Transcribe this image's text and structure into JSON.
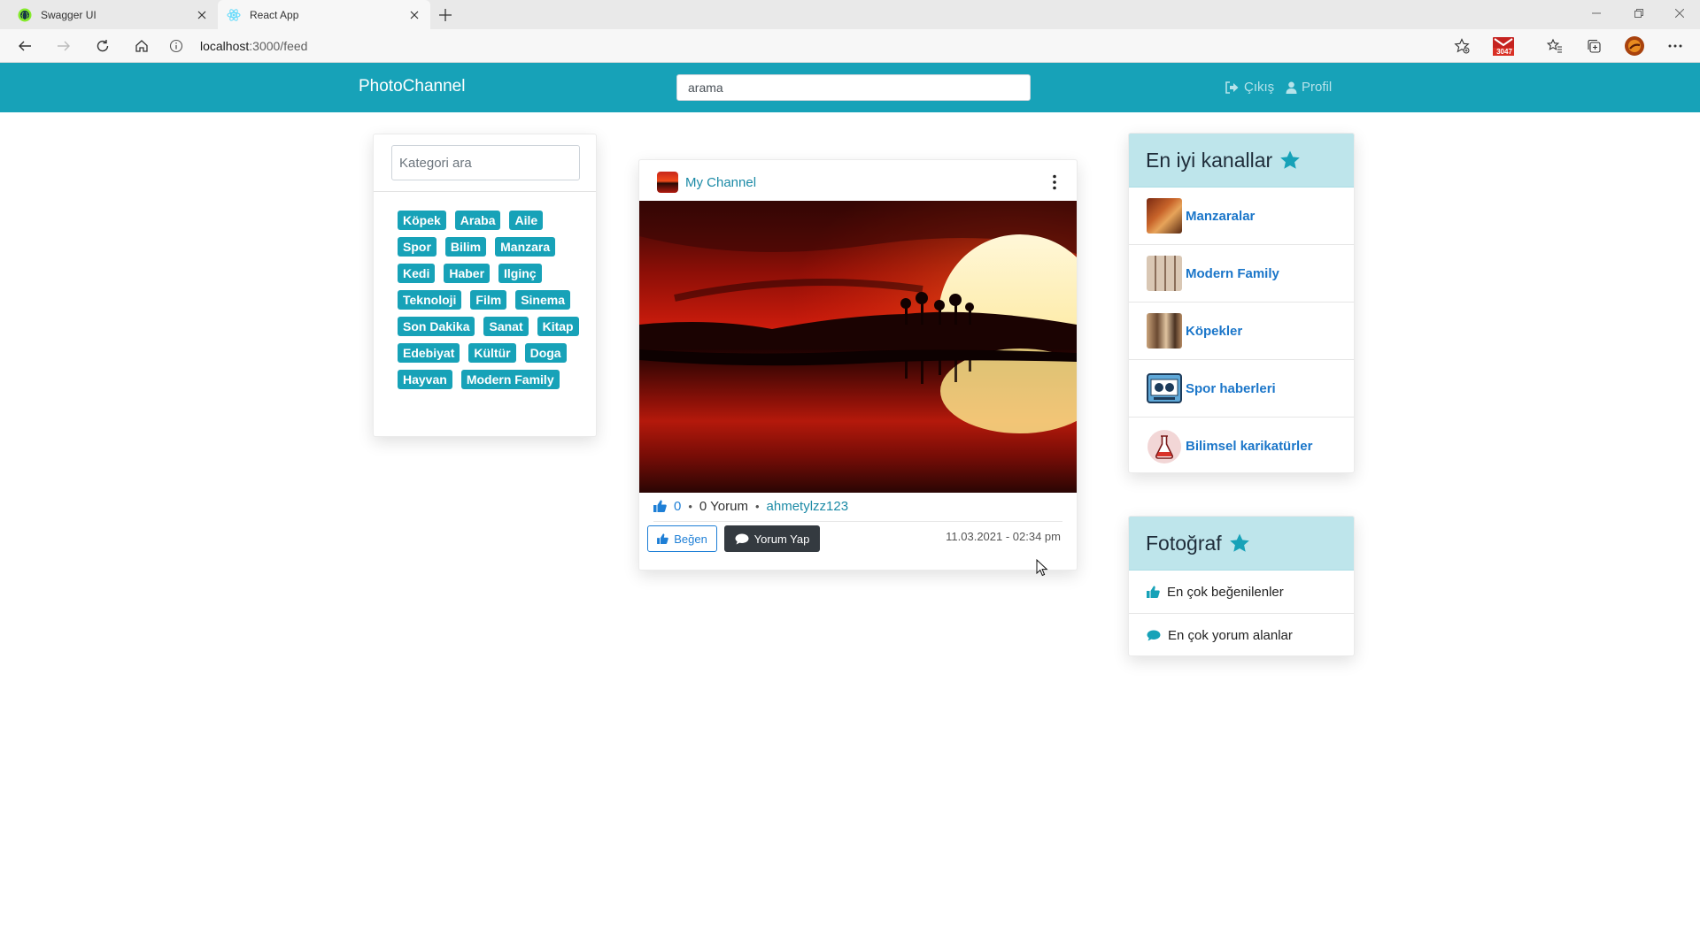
{
  "browser": {
    "tabs": [
      {
        "title": "Swagger UI",
        "active": false
      },
      {
        "title": "React App",
        "active": true
      }
    ],
    "address": {
      "host": "localhost",
      "path": ":3000/feed"
    },
    "extension_badge": "3047"
  },
  "navbar": {
    "brand": "PhotoChannel",
    "search_value": "arama",
    "logout_label": "Çıkış",
    "profile_label": "Profil",
    "bg_color": "#17a2b8"
  },
  "categories": {
    "search_placeholder": "Kategori ara",
    "items": [
      "Köpek",
      "Araba",
      "Aile",
      "Spor",
      "Bilim",
      "Manzara",
      "Kedi",
      "Haber",
      "Ilginç",
      "Teknoloji",
      "Film",
      "Sinema",
      "Son Dakika",
      "Sanat",
      "Kitap",
      "Edebiyat",
      "Kültür",
      "Doga",
      "Hayvan",
      "Modern Family"
    ]
  },
  "post": {
    "channel_name": "My Channel",
    "likes": "0",
    "comments": "0 Yorum",
    "username": "ahmetylzz123",
    "like_label": "Beğen",
    "comment_label": "Yorum Yap",
    "date": "11.03.2021 - 02:34 pm"
  },
  "top_channels": {
    "title": "En iyi kanallar",
    "items": [
      {
        "label": "Manzaralar",
        "icon": "landscape-thumb"
      },
      {
        "label": "Modern Family",
        "icon": "family-thumb"
      },
      {
        "label": "Köpekler",
        "icon": "dogs-thumb"
      },
      {
        "label": "Spor haberleri",
        "icon": "sports-news-thumb"
      },
      {
        "label": "Bilimsel karikatürler",
        "icon": "science-flask-thumb"
      }
    ]
  },
  "photo_section": {
    "title": "Fotoğraf",
    "items": [
      {
        "label": "En çok beğenilenler",
        "icon": "thumbs-up-icon"
      },
      {
        "label": "En çok yorum alanlar",
        "icon": "comment-icon"
      }
    ]
  }
}
